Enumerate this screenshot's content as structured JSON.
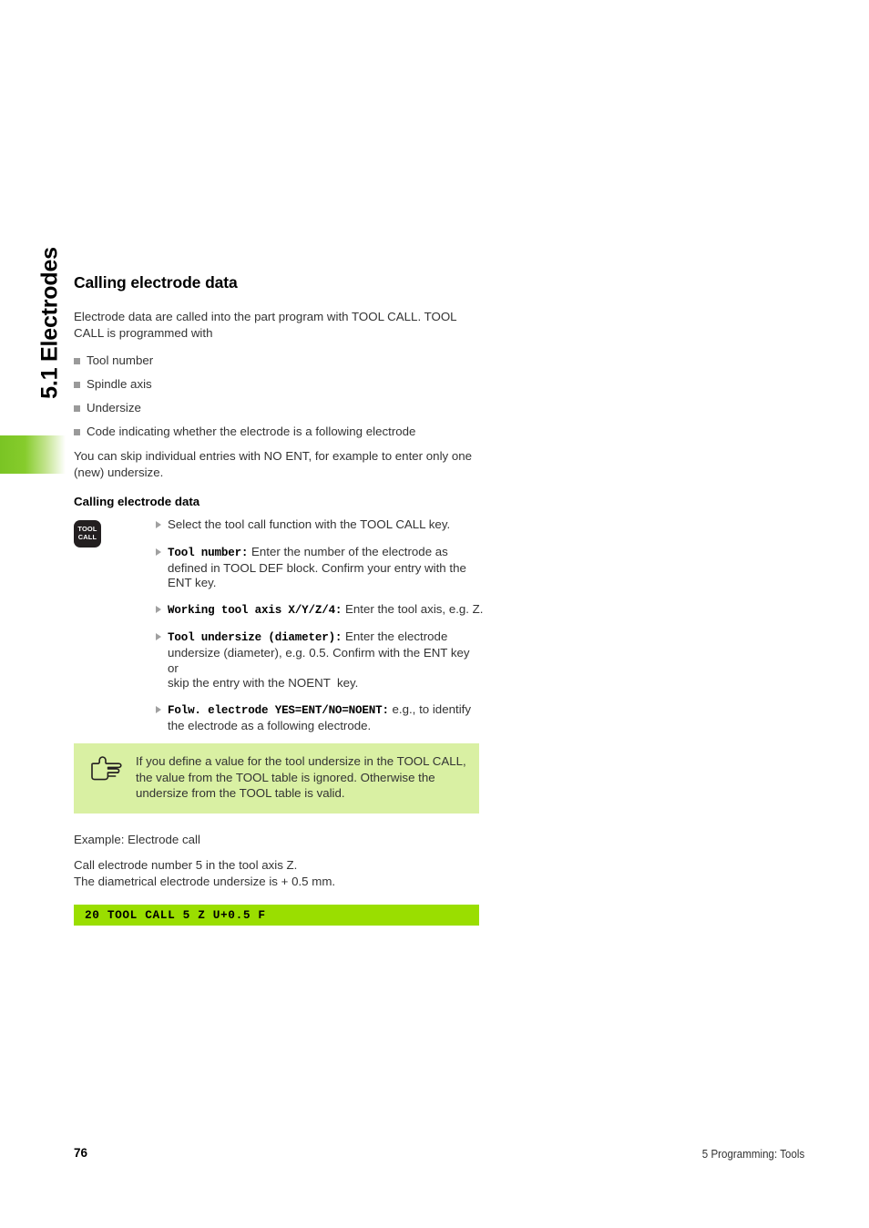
{
  "running_head": "5.1 Electrodes",
  "section": {
    "title": "Calling electrode data",
    "intro": "Electrode data are called into the part program with TOOL CALL. TOOL CALL is programmed with",
    "bullets": [
      "Tool number",
      "Spindle axis",
      "Undersize",
      "Code indicating whether the electrode is a following electrode"
    ],
    "after_bullets": "You can skip individual entries with NO ENT, for example to enter only one (new) undersize."
  },
  "procedure": {
    "heading": "Calling electrode data",
    "key_icon": {
      "name": "tool-call-key",
      "line1": "TOOL",
      "line2": "CALL"
    },
    "steps": [
      {
        "code": "",
        "text": "Select the tool call function with the TOOL CALL key."
      },
      {
        "code": "Tool number:",
        "text": " Enter the number of the electrode as defined in TOOL DEF block. Confirm your entry with the ENT key."
      },
      {
        "code": "Working tool axis X/Y/Z/4:",
        "text": " Enter the tool axis, e.g. Z."
      },
      {
        "code": "Tool undersize (diameter):",
        "text": " Enter the electrode undersize (diameter), e.g. 0.5. Confirm with the ENT key or\nskip the entry with the NOENT  key."
      },
      {
        "code": "Folw. electrode YES=ENT/NO=NOENT:",
        "text": " e.g., to identify the electrode as a following electrode."
      }
    ]
  },
  "note": {
    "icon": "pointing-hand-icon",
    "text": "If you define a value for the tool undersize in the TOOL CALL, the value from the TOOL table is ignored. Otherwise the undersize from the TOOL table is valid."
  },
  "example": {
    "caption": "Example: Electrode call",
    "description": "Call electrode number 5 in the tool axis Z.\nThe diametrical electrode undersize is + 0.5 mm.",
    "code_line": "20 TOOL CALL 5 Z U+0.5 F"
  },
  "footer": {
    "page_number": "76",
    "chapter": "5 Programming: Tools"
  },
  "colors": {
    "accent_green": "#9ade00",
    "note_green": "#d9f0a3",
    "tab_green": "#7ac424",
    "bullet_gray": "#9a9a9a",
    "key_dark": "#231f20"
  }
}
